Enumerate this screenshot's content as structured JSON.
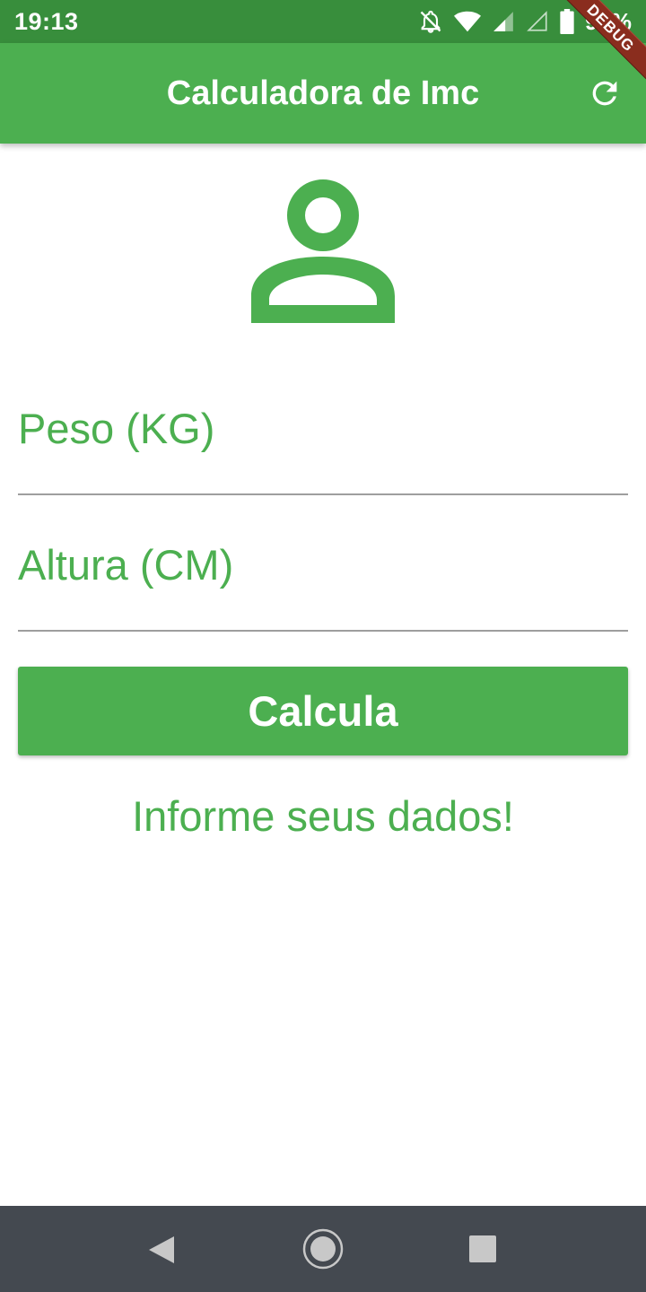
{
  "status_bar": {
    "time": "19:13",
    "battery_percent": "95%",
    "icons": [
      "notifications-off-icon",
      "wifi-icon",
      "signal-icon",
      "signal-empty-icon",
      "battery-icon"
    ]
  },
  "app_bar": {
    "title": "Calculadora de Imc",
    "refresh_icon": "refresh-icon",
    "debug_banner": "DEBUG",
    "color": "#4caf50"
  },
  "avatar_icon": "person-outline-icon",
  "form": {
    "weight": {
      "label": "Peso (KG)",
      "value": ""
    },
    "height": {
      "label": "Altura (CM)",
      "value": ""
    }
  },
  "calculate_button": {
    "label": "Calcula"
  },
  "info_text": "Informe seus dados!",
  "nav_bar": {
    "icons": [
      "back-icon",
      "home-icon",
      "recents-icon"
    ]
  },
  "colors": {
    "primary": "#4caf50",
    "status_bar": "#388e3c",
    "nav_bar": "#444950",
    "underline": "#9e9e9e"
  }
}
